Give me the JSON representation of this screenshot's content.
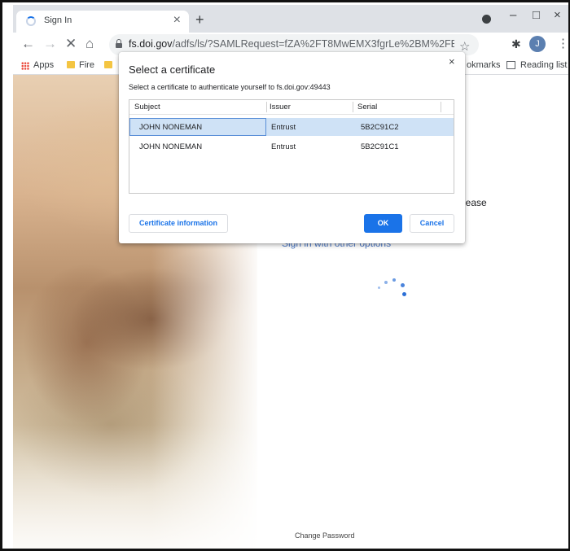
{
  "browser": {
    "tab": {
      "title": "Sign In",
      "close_glyph": "×"
    },
    "new_tab_glyph": "+",
    "window": {
      "minimize": "–",
      "maximize": "□",
      "close": "×"
    },
    "toolbar": {
      "back": "←",
      "forward": "→",
      "stop": "✕",
      "home": "⌂",
      "url_host": "fs.doi.gov",
      "url_rest": "/adfs/ls/?SAMLRequest=fZA%2FT8MwEMX3fgrLe%2BM%2FBJKckkiVulQqCyA...",
      "star_glyph": "☆",
      "extensions_glyph": "✱",
      "profile_initial": "J",
      "menu_glyph": "⋮"
    },
    "bookmarks": {
      "apps": "Apps",
      "fire": "Fire",
      "other_bookmarks_partial": "okmarks",
      "reading_list": "Reading list"
    }
  },
  "page": {
    "please_text": "lease",
    "other_options_text": "Sign in with other options",
    "change_password": "Change Password"
  },
  "dialog": {
    "title": "Select a certificate",
    "close_glyph": "×",
    "subtitle": "Select a certificate to authenticate yourself to fs.doi.gov:49443",
    "columns": [
      "Subject",
      "Issuer",
      "Serial"
    ],
    "rows": [
      {
        "subject": "JOHN NONEMAN",
        "issuer": "Entrust",
        "serial": "5B2C91C2",
        "selected": true
      },
      {
        "subject": "JOHN NONEMAN",
        "issuer": "Entrust",
        "serial": "5B2C91C1",
        "selected": false
      }
    ],
    "buttons": {
      "info": "Certificate information",
      "ok": "OK",
      "cancel": "Cancel"
    }
  },
  "colors": {
    "accent": "#1a73e8",
    "selection": "#cfe2f6",
    "tabstrip": "#dee1e6"
  }
}
